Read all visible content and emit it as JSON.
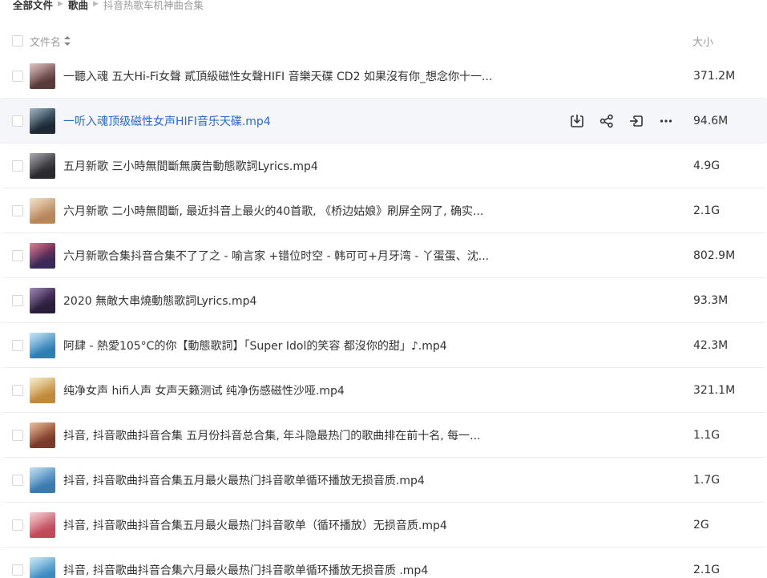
{
  "breadcrumb": [
    {
      "label": "全部文件"
    },
    {
      "label": "歌曲"
    },
    {
      "label": "抖音热歌车机神曲合集"
    }
  ],
  "header": {
    "name_label": "文件名",
    "size_label": "大小"
  },
  "files": [
    {
      "name": "一聽入魂 五大Hi-Fi女聲 貳頂級磁性女聲HIFI 音樂天碟 CD2 如果沒有你_想念你十一...",
      "size": "371.2M",
      "thumb": "#5a3b3b",
      "thumb2": "#c9a3a0"
    },
    {
      "name": "一听入魂顶级磁性女声HIFI音乐天碟.mp4",
      "size": "94.6M",
      "thumb": "#1d2a35",
      "thumb2": "#6b8aa0"
    },
    {
      "name": "五月新歌 三小時無間斷無廣告動態歌詞Lyrics.mp4",
      "size": "4.9G",
      "thumb": "#2a2a2e",
      "thumb2": "#7a7a82"
    },
    {
      "name": "六月新歌 二小時無間斷, 最近抖音上最火的40首歌, 《桥边姑娘》刷屏全网了, 确实...",
      "size": "2.1G",
      "thumb": "#b8865a",
      "thumb2": "#e8d0b0"
    },
    {
      "name": "六月新歌合集抖音合集不了了之 - 喻言家 +错位时空 - 韩可可+月牙湾 - 丫蛋蛋、沈...",
      "size": "802.9M",
      "thumb": "#3a2a5a",
      "thumb2": "#c23a5a"
    },
    {
      "name": "2020 無敵大串燒動態歌詞Lyrics.mp4",
      "size": "93.3M",
      "thumb": "#2a1e3a",
      "thumb2": "#6a4a8a"
    },
    {
      "name": "阿肆 - 熱愛105°C的你【動態歌詞】「Super Idol的笑容 都沒你的甜」♪.mp4",
      "size": "42.3M",
      "thumb": "#2f7fb5",
      "thumb2": "#a8d4ee"
    },
    {
      "name": "纯净女声 hifi人声 女声天籁测试 纯净伤感磁性沙哑.mp4",
      "size": "321.1M",
      "thumb": "#c08a3a",
      "thumb2": "#f2e0b0"
    },
    {
      "name": "抖音, 抖音歌曲抖音合集 五月份抖音总合集, 年斗隐最热门的歌曲排在前十名, 每一...",
      "size": "1.1G",
      "thumb": "#7a3a2a",
      "thumb2": "#d99a6a"
    },
    {
      "name": "抖音, 抖音歌曲抖音合集五月最火最热门抖音歌单循环播放无损音质.mp4",
      "size": "1.7G",
      "thumb": "#3a7ab0",
      "thumb2": "#a0cce8"
    },
    {
      "name": "抖音, 抖音歌曲抖音合集五月最火最热门抖音歌单（循环播放）无损音质.mp4",
      "size": "2G",
      "thumb": "#c04a5a",
      "thumb2": "#f0b8c0"
    },
    {
      "name": "抖音, 抖音歌曲抖音合集六月最火最热门抖音歌单循环播放无损音质 .mp4",
      "size": "2.1G",
      "thumb": "#3a8ac0",
      "thumb2": "#b0dcf0"
    }
  ],
  "hover_row_index": 1,
  "row_actions": [
    {
      "icon": "download-icon"
    },
    {
      "icon": "share-icon"
    },
    {
      "icon": "move-icon"
    },
    {
      "icon": "more-icon"
    }
  ],
  "colors": {
    "accent_link": "#2a68d6",
    "hover_bg": "#f5f6fa",
    "text": "#333333",
    "muted": "#999999"
  }
}
